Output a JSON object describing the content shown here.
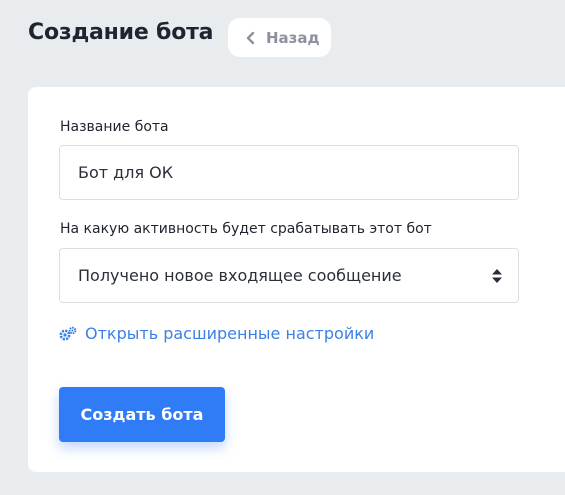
{
  "header": {
    "title": "Создание бота",
    "back_label": "Назад"
  },
  "form": {
    "name_label": "Название бота",
    "name_value": "Бот для ОК",
    "trigger_label": "На какую активность будет срабатывать этот бот",
    "trigger_value": "Получено новое входящее сообщение",
    "advanced_link": "Открыть расширенные настройки",
    "submit_label": "Создать бота"
  },
  "icons": {
    "back": "chevron-left-icon",
    "select": "sort-arrows-icon",
    "advanced": "gears-icon"
  },
  "colors": {
    "background": "#e8ecef",
    "accent": "#2f7cf6",
    "link": "#3b80e6"
  }
}
